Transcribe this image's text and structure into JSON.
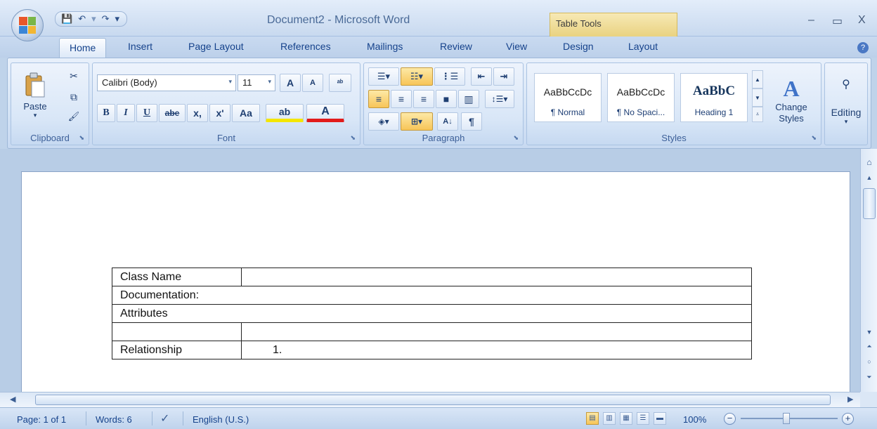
{
  "window": {
    "title": "Document2 - Microsoft Word",
    "context_tab_group": "Table Tools",
    "controls": {
      "minimize": "–",
      "maximize": "▭",
      "close": "X"
    }
  },
  "quick_access": {
    "save_icon": "💾",
    "undo_icon": "↶",
    "redo_icon": "↷",
    "customize_icon": "▾"
  },
  "tabs": [
    {
      "label": "Home",
      "active": true
    },
    {
      "label": "Insert"
    },
    {
      "label": "Page Layout"
    },
    {
      "label": "References"
    },
    {
      "label": "Mailings"
    },
    {
      "label": "Review"
    },
    {
      "label": "View"
    },
    {
      "label": "Design"
    },
    {
      "label": "Layout"
    }
  ],
  "ribbon": {
    "clipboard": {
      "label": "Clipboard",
      "paste": "Paste",
      "cut_icon": "✂",
      "copy_icon": "⧉",
      "format_painter_icon": "🖌"
    },
    "font": {
      "label": "Font",
      "font_name": "Calibri (Body)",
      "font_size": "11",
      "grow": "A",
      "shrink": "A",
      "bold": "B",
      "italic": "I",
      "underline": "U",
      "strike": "abe",
      "subscript": "x,",
      "superscript": "x'",
      "change_case": "Aa",
      "highlight": "ab",
      "font_color": "A"
    },
    "paragraph": {
      "label": "Paragraph",
      "sort_icon": "A↓",
      "pilcrow": "¶"
    },
    "styles": {
      "label": "Styles",
      "items": [
        {
          "sample": "AaBbCcDc",
          "name": "¶ Normal"
        },
        {
          "sample": "AaBbCcDc",
          "name": "¶ No Spaci..."
        },
        {
          "sample": "AaBbC",
          "name": "Heading 1"
        }
      ],
      "change_styles": "Change Styles"
    },
    "editing": {
      "label": "Editing"
    }
  },
  "document": {
    "table": {
      "class_name_label": "Class Name",
      "class_name_value": "",
      "documentation_label": "Documentation:",
      "attributes_label": "Attributes",
      "empty_left": "",
      "empty_right": "",
      "relationship_label": "Relationship",
      "relationship_value": "1."
    }
  },
  "status": {
    "page": "Page: 1 of 1",
    "words": "Words: 6",
    "language": "English (U.S.)",
    "zoom": "100%",
    "zoom_out": "−",
    "zoom_in": "+"
  }
}
